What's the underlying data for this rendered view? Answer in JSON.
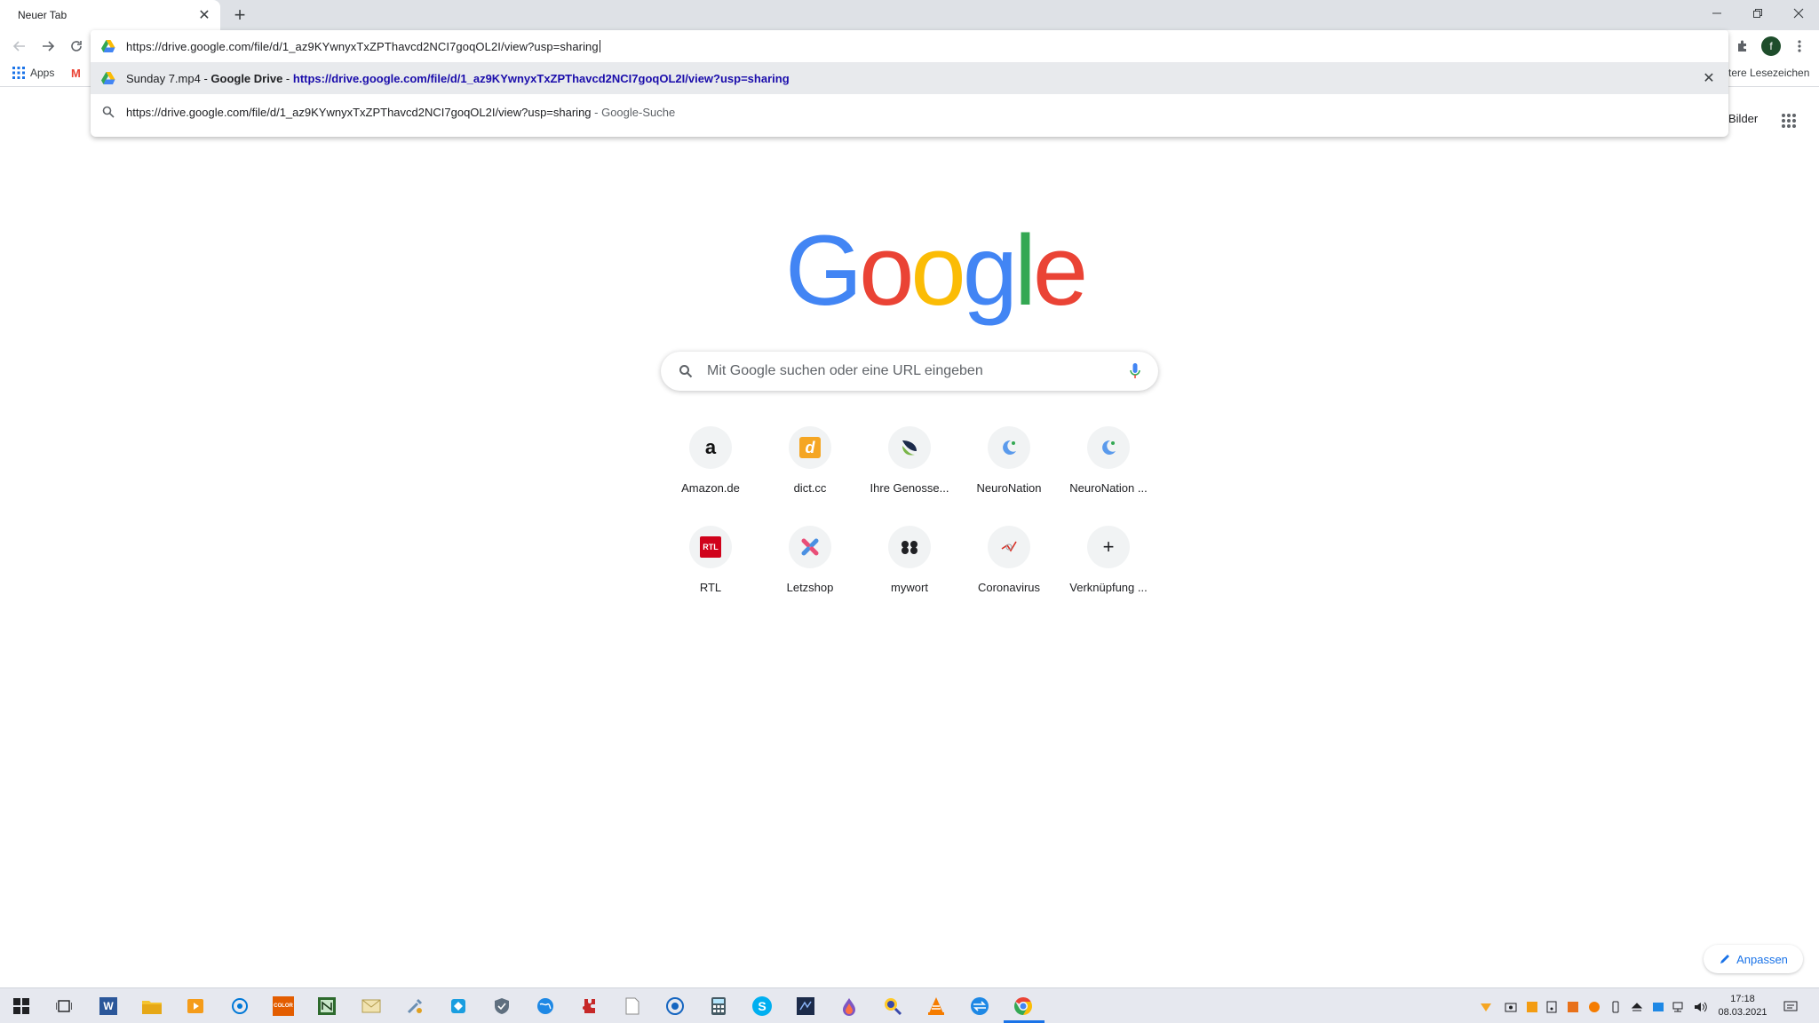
{
  "browser": {
    "tab_title": "Neuer Tab",
    "new_tab_symbol": "+",
    "omnibox_text": "https://drive.google.com/file/d/1_az9KYwnyxTxZPThavcd2NCI7goqOL2I/view?usp=sharing",
    "suggestions": [
      {
        "prefix": "Sunday 7.mp4 - ",
        "site": "Google Drive",
        "separator": " - ",
        "url": "https://drive.google.com/file/d/1_az9KYwnyxTxZPThavcd2NCI7goqOL2I/view?usp=sharing",
        "icon": "google-drive-icon"
      },
      {
        "query": "https://drive.google.com/file/d/1_az9KYwnyxTxZPThavcd2NCI7goqOL2I/view?usp=sharing",
        "suffix": " - Google-Suche",
        "icon": "search-icon"
      }
    ],
    "profile_initial": "f"
  },
  "bookmarks": {
    "apps_label": "Apps",
    "gmail_letter": "M",
    "other_label": "tere Lesezeichen"
  },
  "ntp": {
    "images_link": "Bilder",
    "logo_letters": [
      "G",
      "o",
      "o",
      "g",
      "l",
      "e"
    ],
    "logo_colors": [
      "#4285f4",
      "#ea4335",
      "#fbbc05",
      "#4285f4",
      "#34a853",
      "#ea4335"
    ],
    "search_placeholder": "Mit Google suchen oder eine URL eingeben",
    "tiles_row1": [
      {
        "label": "Amazon.de",
        "glyph": "a"
      },
      {
        "label": "dict.cc",
        "glyph": "d"
      },
      {
        "label": "Ihre Genosse...",
        "glyph": ""
      },
      {
        "label": "NeuroNation",
        "glyph": ""
      },
      {
        "label": "NeuroNation ...",
        "glyph": ""
      }
    ],
    "tiles_row2": [
      {
        "label": "RTL",
        "glyph": "RTL"
      },
      {
        "label": "Letzshop",
        "glyph": ""
      },
      {
        "label": "mywort",
        "glyph": ""
      },
      {
        "label": "Coronavirus",
        "glyph": ""
      },
      {
        "label": "Verknüpfung ...",
        "glyph": "+"
      }
    ],
    "customize_label": "Anpassen"
  },
  "taskbar": {
    "clock_time": "17:18",
    "clock_date": "08.03.2021",
    "word_letter": "W",
    "color_label": "COLOR",
    "skype_letter": "S"
  },
  "colors": {
    "accent": "#1a73e8",
    "link": "#1a0dab",
    "tabstrip": "#dee1e6"
  }
}
